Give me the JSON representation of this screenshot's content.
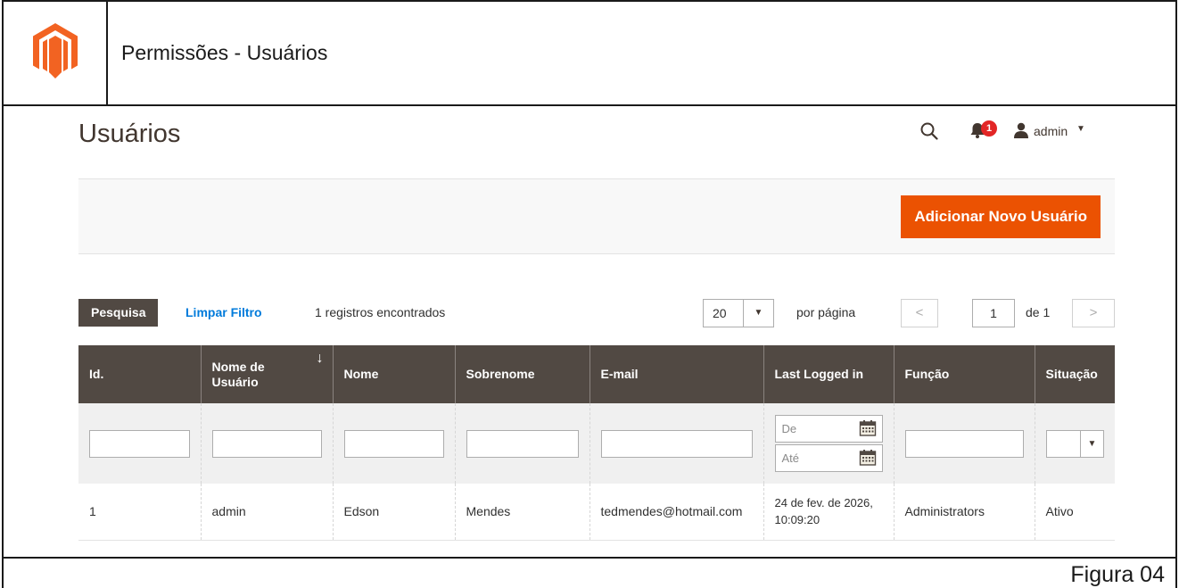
{
  "document": {
    "title": "Permissões - Usuários",
    "caption": "Figura 04"
  },
  "page": {
    "title": "Usuários",
    "header": {
      "notifications_count": "1",
      "user_name": "admin"
    },
    "actions": {
      "add_user_label": "Adicionar Novo Usuário"
    }
  },
  "toolbar": {
    "search_label": "Pesquisa",
    "reset_label": "Limpar Filtro",
    "records_found": "1 registros encontrados",
    "per_page_value": "20",
    "per_page_label": "por página",
    "current_page": "1",
    "page_total": "de 1"
  },
  "grid": {
    "columns": [
      "Id.",
      "Nome de Usuário",
      "Nome",
      "Sobrenome",
      "E-mail",
      "Last Logged in",
      "Função",
      "Situação"
    ],
    "filters": {
      "date_from_placeholder": "De",
      "date_to_placeholder": "Até"
    },
    "rows": [
      {
        "id": "1",
        "username": "admin",
        "firstname": "Edson",
        "lastname": "Mendes",
        "email": "tedmendes@hotmail.com",
        "last_login": "24 de fev. de 2026, 10:09:20",
        "role": "Administrators",
        "status": "Ativo"
      }
    ]
  },
  "colors": {
    "brand_orange": "#eb5202",
    "grid_header": "#514943",
    "link_blue": "#007bdb",
    "badge_red": "#e22626"
  },
  "icons": [
    "magento-logo-icon",
    "search-icon",
    "bell-icon",
    "user-icon",
    "calendar-icon",
    "chevron-left-icon",
    "chevron-right-icon",
    "sort-arrow-icon"
  ]
}
